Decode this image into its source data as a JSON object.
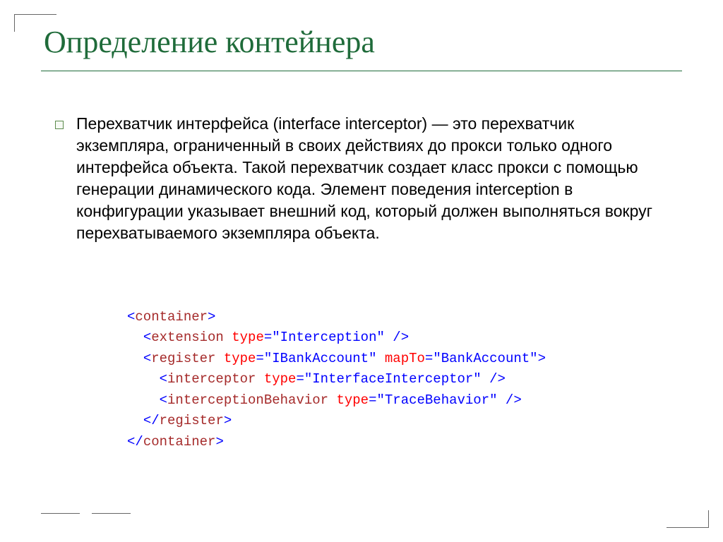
{
  "title": "Определение контейнера",
  "paragraph": "Перехватчик интерфейса (interface interceptor) — это перехватчик экземпляра, ограниченный в своих действиях до прокси только одного интерфейса объекта. Такой перехватчик создает класс прокси с помощью генерации динамического кода. Элемент поведения interception в конфигурации указывает внешний код, который должен выполняться вокруг перехватываемого экземпляра объекта.",
  "code": {
    "line1": {
      "tag_open": "<",
      "tag_name": "container",
      "tag_close": ">"
    },
    "line2": {
      "indent": "  ",
      "tag_open": "<",
      "tag_name": "extension",
      "sp1": " ",
      "attr1": "type",
      "eq1": "=",
      "val1": "\"Interception\"",
      "tag_close": " />"
    },
    "line3": {
      "indent": "  ",
      "tag_open": "<",
      "tag_name": "register",
      "sp1": " ",
      "attr1": "type",
      "eq1": "=",
      "val1": "\"IBankAccount\"",
      "sp2": " ",
      "attr2": "mapTo",
      "eq2": "=",
      "val2": "\"BankAccount\"",
      "tag_close": ">"
    },
    "line4": {
      "indent": "    ",
      "tag_open": "<",
      "tag_name": "interceptor",
      "sp1": " ",
      "attr1": "type",
      "eq1": "=",
      "val1": "\"InterfaceInterceptor\"",
      "tag_close": " />"
    },
    "line5": {
      "indent": "    ",
      "tag_open": "<",
      "tag_name": "interceptionBehavior",
      "sp1": " ",
      "attr1": "type",
      "eq1": "=",
      "val1": "\"TraceBehavior\"",
      "tag_close": " />"
    },
    "line6": {
      "indent": "  ",
      "tag_open": "</",
      "tag_name": "register",
      "tag_close": ">"
    },
    "line7": {
      "tag_open": "</",
      "tag_name": "container",
      "tag_close": ">"
    }
  }
}
